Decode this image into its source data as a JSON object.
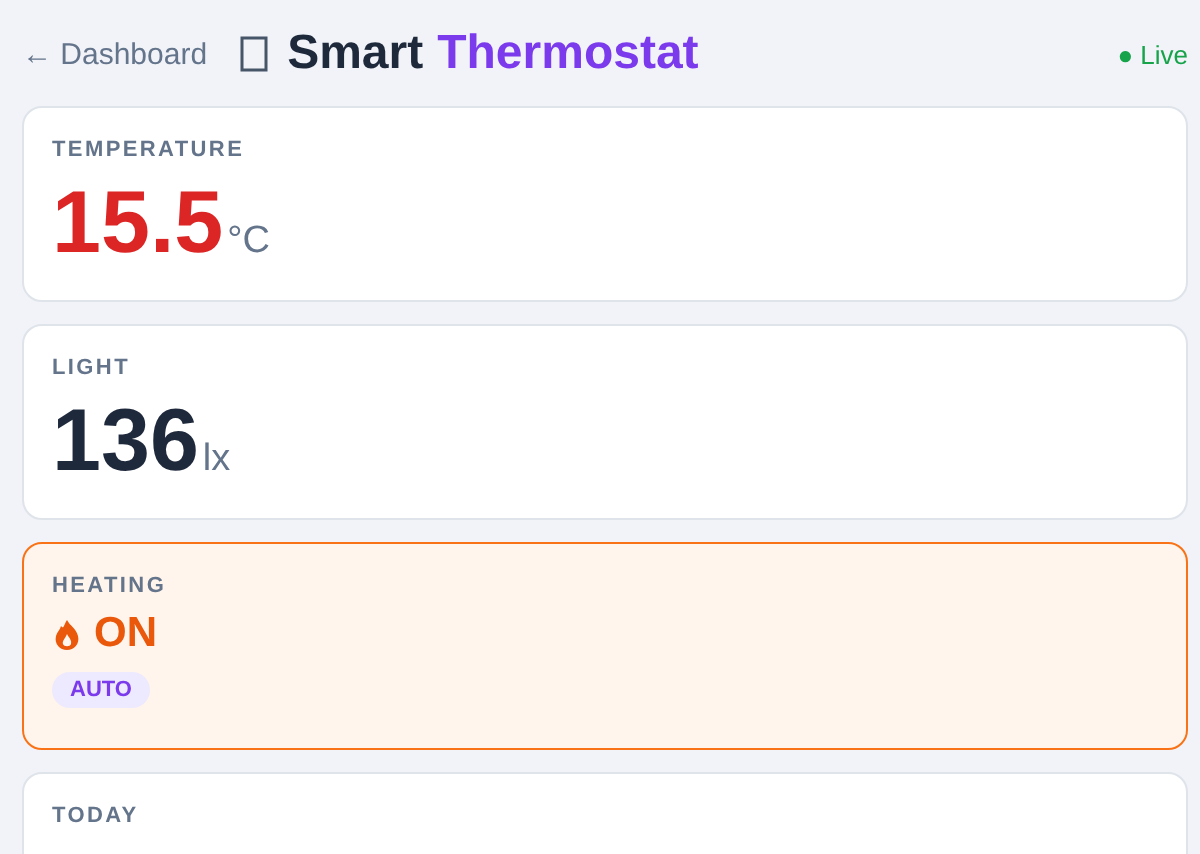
{
  "header": {
    "back_link": "← Dashboard",
    "title_plain": "Smart",
    "title_accent": "Thermostat",
    "status": "● Live"
  },
  "cards": [
    {
      "kind": "reading",
      "label": "TEMPERATURE",
      "value": "15.5",
      "unit": "°C",
      "color": "#dc2626"
    },
    {
      "kind": "reading",
      "label": "LIGHT",
      "value": "136",
      "unit": "lx",
      "color": "#1e293b"
    },
    {
      "kind": "status",
      "label": "HEATING",
      "value": "ON",
      "on": true,
      "badge": "AUTO"
    },
    {
      "kind": "heading",
      "label": "TODAY"
    }
  ]
}
